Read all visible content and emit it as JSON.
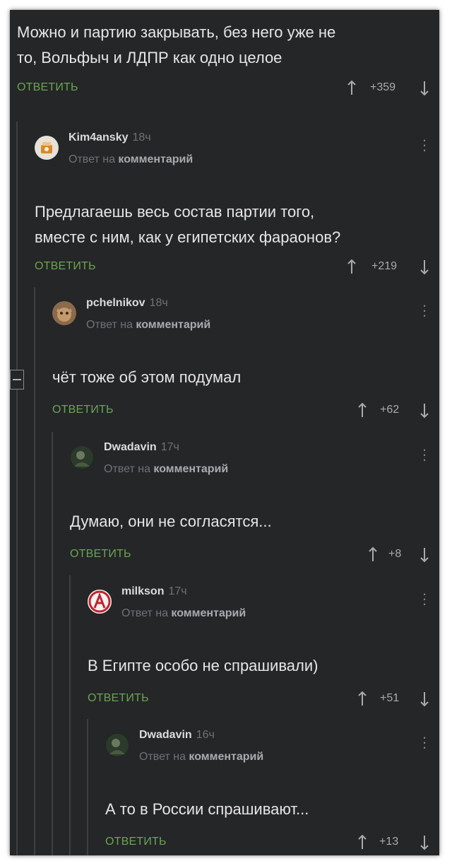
{
  "root": {
    "text_line1": "Можно и партию закрывать, без него уже не",
    "text_line2": "то, Вольфыч и ЛДПР как одно целое",
    "reply_label": "ОТВЕТИТЬ",
    "rating": "+359"
  },
  "comments": [
    {
      "author": "Kim4ansky",
      "time": "18ч",
      "reply_prefix": "Ответ на",
      "reply_target": "комментарий",
      "text_line1": "Предлагаешь весь состав партии того,",
      "text_line2": "вместе с ним, как у египетских фараонов?",
      "reply_label": "ОТВЕТИТЬ",
      "rating": "+219"
    },
    {
      "author": "pchelnikov",
      "time": "18ч",
      "reply_prefix": "Ответ на",
      "reply_target": "комментарий",
      "text_line1": "чёт тоже об этом подумал",
      "reply_label": "ОТВЕТИТЬ",
      "rating": "+62"
    },
    {
      "author": "Dwadavin",
      "time": "17ч",
      "reply_prefix": "Ответ на",
      "reply_target": "комментарий",
      "text_line1": "Думаю, они не согласятся...",
      "reply_label": "ОТВЕТИТЬ",
      "rating": "+8"
    },
    {
      "author": "milkson",
      "time": "17ч",
      "reply_prefix": "Ответ на",
      "reply_target": "комментарий",
      "text_line1": "В Египте особо не спрашивали)",
      "reply_label": "ОТВЕТИТЬ",
      "rating": "+51"
    },
    {
      "author": "Dwadavin",
      "time": "16ч",
      "reply_prefix": "Ответ на",
      "reply_target": "комментарий",
      "text_line1": "А то в России спрашивают...",
      "reply_label": "ОТВЕТИТЬ",
      "rating": "+13"
    }
  ],
  "icons": {
    "upvote": "arrow-up-icon",
    "downvote": "arrow-down-icon",
    "menu": "more-vertical-icon",
    "collapse": "collapse-thread-icon"
  },
  "colors": {
    "background": "#252628",
    "text": "#e6e6e6",
    "reply_link": "#6aa552",
    "muted": "#6f7276",
    "thread_line": "#3d3f42"
  }
}
